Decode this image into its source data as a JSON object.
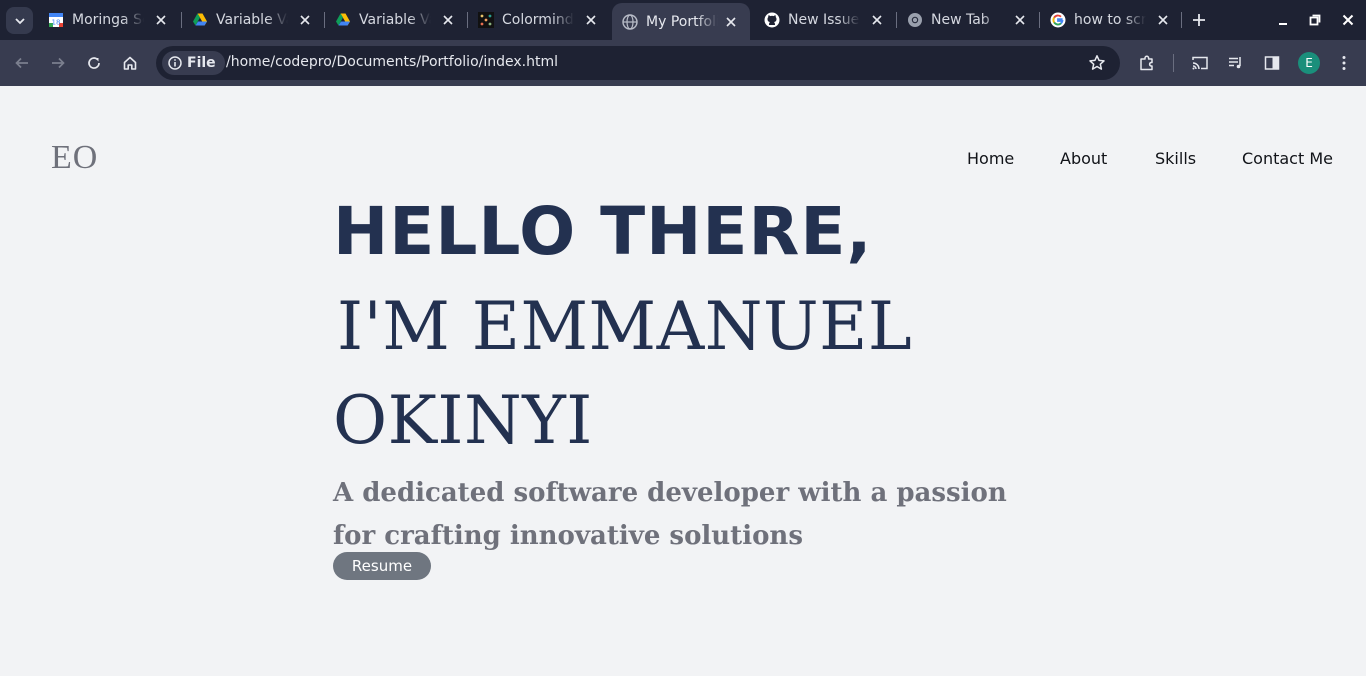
{
  "browser": {
    "tabs": [
      {
        "title": "Moringa School",
        "icon": "google-calendar-icon",
        "active": false
      },
      {
        "title": "Variable Values",
        "icon": "google-drive-icon",
        "active": false
      },
      {
        "title": "Variable Values",
        "icon": "google-drive-icon",
        "active": false
      },
      {
        "title": "Colormind",
        "icon": "colormind-icon",
        "active": false
      },
      {
        "title": "My Portfolio",
        "icon": "globe-icon",
        "active": true
      },
      {
        "title": "New Issue",
        "icon": "github-icon",
        "active": false
      },
      {
        "title": "New Tab",
        "icon": "chrome-icon",
        "active": false
      },
      {
        "title": "how to screenshot",
        "icon": "google-icon",
        "active": false
      }
    ],
    "omnibox": {
      "scheme_label": "File",
      "url": "/home/codepro/Documents/Portfolio/index.html"
    },
    "profile_initial": "E",
    "colors": {
      "tabbar": "#1e2233",
      "toolbar": "#383c50",
      "profile": "#1a8f7b"
    }
  },
  "site": {
    "logo": "EO",
    "nav": [
      "Home",
      "About",
      "Skills",
      "Contact Me"
    ],
    "hero": {
      "greeting": "HELLO THERE,",
      "name_line1": "I'M EMMANUEL",
      "name_line2": "OKINYI",
      "tagline": "A dedicated software developer with a passion for crafting innovative solutions",
      "resume_label": "Resume"
    },
    "colors": {
      "heading": "#233150",
      "muted": "#6f717b",
      "background": "#f2f3f5",
      "button": "#6f7680"
    }
  }
}
